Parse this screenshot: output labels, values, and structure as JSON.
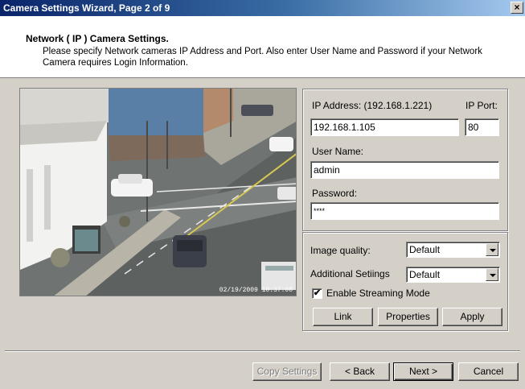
{
  "window": {
    "title": "Camera Settings Wizard, Page 2 of 9",
    "close_label": "×"
  },
  "header": {
    "title": "Network ( IP ) Camera Settings.",
    "description": "Please specify Network cameras IP Address and Port. Also enter User Name and Password if your Network Camera requires Login Information."
  },
  "preview": {
    "timestamp": "02/19/2009 10:37:08"
  },
  "connection": {
    "ip_label": "IP Address: (192.168.1.221)",
    "ip_value": "192.168.1.105",
    "port_label": "IP  Port:",
    "port_value": "80",
    "username_label": "User Name:",
    "username_value": "admin",
    "password_label": "Password:",
    "password_value": "****"
  },
  "options": {
    "image_quality_label": "Image quality:",
    "image_quality_value": "Default",
    "additional_label": "Additional Setiings",
    "additional_value": "Default",
    "streaming_label": "Enable Streaming Mode",
    "streaming_checked": true,
    "link_label": "Link",
    "properties_label": "Properties",
    "apply_label": "Apply"
  },
  "footer": {
    "copy_label": "Copy Settings",
    "back_label": "< Back",
    "next_label": "Next >",
    "cancel_label": "Cancel"
  }
}
